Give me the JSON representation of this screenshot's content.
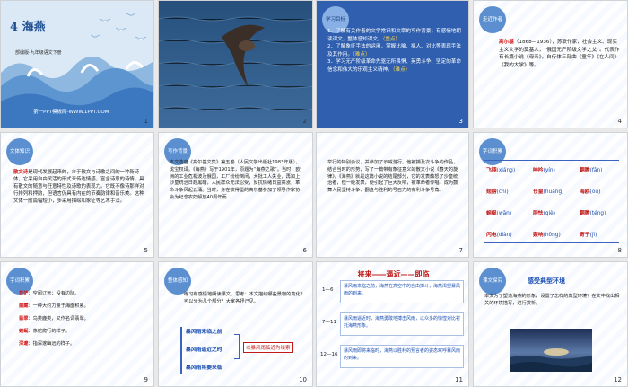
{
  "slide1": {
    "title_num": "4",
    "title": "海燕",
    "subtitle": "部编版·九年级语文下册",
    "footer": "第一PPT模板网-WWW.1PPT.COM",
    "num": "1"
  },
  "slide2": {
    "num": "2"
  },
  "slide3": {
    "tag": "学习目标",
    "items": [
      "1．了解有关作者的文学常识和文章的写作背景；有感情地朗读课文，整体感知课文。",
      "（重点）",
      "2．了解象征手法的运用，掌握比喻、拟人、对比等表现手法及其作用。",
      "（难点）",
      "3．学习无产阶级革命先驱无所畏惧、英勇斗争、坚定的革命信念和伟大的乐观主义精神。",
      "（难点）"
    ],
    "num": "3"
  },
  "slide4": {
    "tag": "走近作者",
    "name": "高尔基",
    "text": "（1868—1936），苏联作家，社会主义、现实主义文学的奠基人，“俄国无产阶级文学之父”。代表作有长篇小说《母亲》，自传体三部曲《童年》《在人间》《我的大学》等。",
    "num": "4"
  },
  "slide5": {
    "tag": "文体知识",
    "lead": "散文诗",
    "text": "是现代发展起来的，介于散文与诗歌之间的一种新诗体，它采用自由灵活的形式来传达情感，富含诗意的诗情，具有散文的随意与任意特性及诗歌的表现力。它既不像诗那样对行排列和押韵，但语言仍具有内在的节奏韵律和音乐美。这种文体一般篇幅短小，多采用描绘和象征等艺术手法。",
    "num": "5"
  },
  "slide6": {
    "tag": "写作背景",
    "text": "本文选自《高尔基文集》第五卷（人民文学出版社1983年版），戈宝权译。《海燕》写于1901年，原题为“海燕之歌”。当时，欧洲的工业危机波及俄国，工厂纷纷倒闭，大批工人失业，再加上沙皇统治日趋黑暗，人民群众无法忍受，反抗情绪日益高涨，革命斗争风起云涌。当时，身在彼得堡的高尔基参加了领导作家协会为纪念农奴解放40周年而",
    "num": "6"
  },
  "slide7": {
    "text": "举行的特别会议，并参加了示威游行。他被捕及次斗争的作品，结合当时的形势，写了一篇带有象征意义的散文小说《春天的旋律》。《海燕》就是这篇小说的结尾部分，它的发表触怒了沙皇统治者，但一经发表，便引起了巨大反响，被革命者传唱，成为鼓舞人民坚持斗争、翻盘与胜利的号召力的有利斗争号角。",
    "num": "7"
  },
  "slide8": {
    "tag": "字词积累",
    "words": [
      [
        "飞翔",
        "(xiáng)",
        "呻吟",
        "(yín)",
        "翻腾",
        "(fān)"
      ],
      [
        "翅膀",
        "(chì)",
        "仓皇",
        "(huáng)",
        "海鸥",
        "(ōu)"
      ],
      [
        "蜿蜒",
        "(wān)",
        "胆怯",
        "(qiè)",
        "翻腾",
        "(téng)"
      ],
      [
        "闪电",
        "(diàn)",
        "轰响",
        "(hōng)",
        "寄予",
        "(jì)"
      ]
    ],
    "num": "8"
  },
  "slide9": {
    "tag": "字词积累",
    "items": [
      {
        "w": "苍茫",
        "d": "空阔辽远；没有边际。"
      },
      {
        "w": "蕴藏",
        "d": "一种大约力量于海面积累。"
      },
      {
        "w": "翡翠",
        "d": "鸟类鹿类，又作名词翡翠。"
      },
      {
        "w": "蜿蜒",
        "d": "像蛇爬行的样子。"
      },
      {
        "w": "深邃",
        "d": "指深邃幽远的样子。"
      }
    ],
    "num": "9"
  },
  "slide10": {
    "tag": "整体感知",
    "question": "练习有感情地朗读课文，思考：本文描绘哪些景物的变化？可以分为几个部分？大家各抒己见。",
    "parts": [
      "暴风雨来临之前",
      "暴风雨逼近之时",
      "暴风雨将要来临"
    ],
    "label": "以暴风雨临近为线索",
    "num": "10"
  },
  "slide11": {
    "title": "将来——逼近——即临",
    "rows": [
      {
        "r": "1—6",
        "t": "暴风雨来临之前，海燕在高空中的自由搏斗，海燕渴望暴风雨的到来。"
      },
      {
        "r": "7—11",
        "t": "暴风雨逼近时，海燕勇敢地搏击风雨，以众多的惊惶对比衬托海燕形象。"
      },
      {
        "r": "12—16",
        "t": "暴风雨即将来临时，海燕以胜利的预言者的姿态欢呼暴风雨的到来。"
      }
    ],
    "num": "11"
  },
  "slide12": {
    "tag": "课文探究",
    "title": "感受典型环境",
    "text": "本文为了塑造海燕的形象，设置了怎样的典型环境？在文中找出相关的环境描写，进行赏析。",
    "num": "12"
  }
}
